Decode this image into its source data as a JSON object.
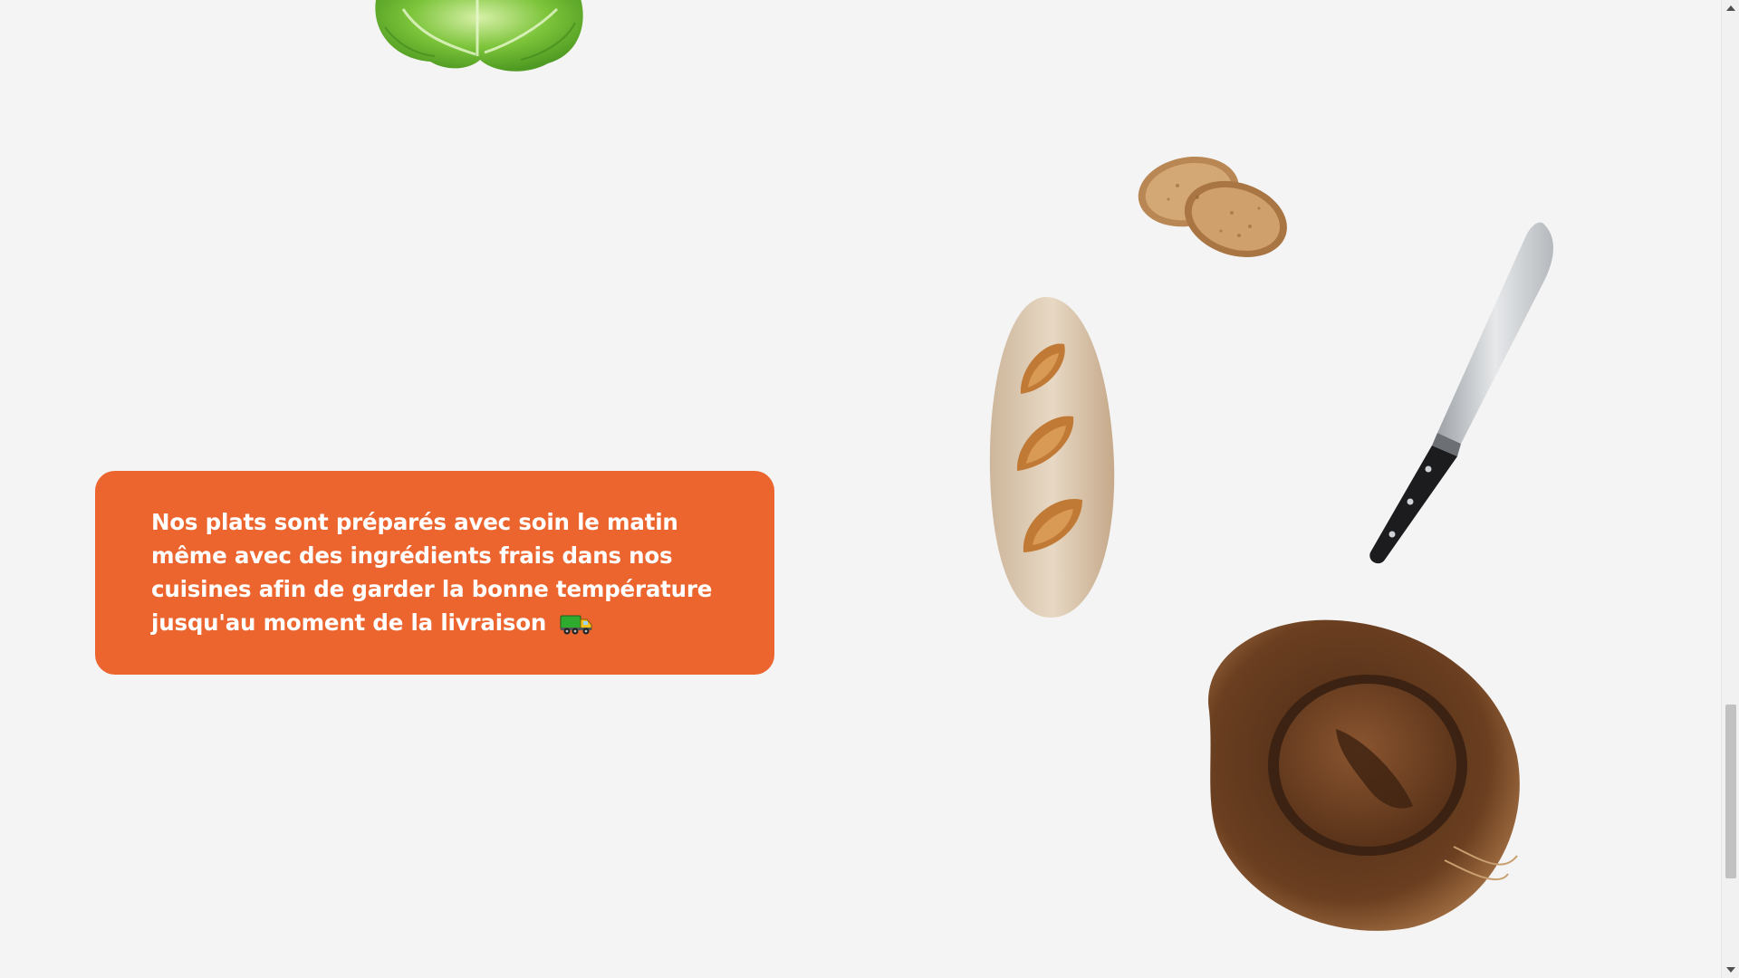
{
  "card": {
    "text": "Nos plats sont préparés avec soin le matin même avec des ingrédients frais dans nos cuisines afin de garder la bonne température jusqu'au moment de la livraison",
    "icon": "delivery-truck-icon",
    "background_color": "#ec652f",
    "text_color": "#ffffff"
  },
  "decorations": [
    "lettuce-image",
    "toast-slices-image",
    "baguette-image",
    "chef-knife-image",
    "cowboy-hat-image"
  ],
  "page": {
    "background_color": "#f4f4f4"
  },
  "scrollbar": {
    "icons": [
      "scroll-up-arrow-icon",
      "scroll-down-arrow-icon"
    ]
  }
}
